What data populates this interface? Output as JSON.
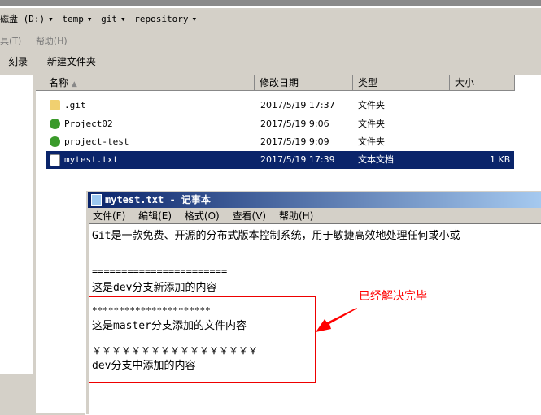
{
  "address": {
    "parts": [
      "磁盘 (D:)",
      "temp",
      "git",
      "repository"
    ]
  },
  "menu": [
    "具(T)",
    "帮助(H)"
  ],
  "toolbar": [
    "刻录",
    "新建文件夹"
  ],
  "columns": [
    "名称",
    "修改日期",
    "类型",
    "大小"
  ],
  "files": [
    {
      "name": ".git",
      "date": "2017/5/19 17:37",
      "type": "文件夹",
      "size": "",
      "icon": "folder-icon"
    },
    {
      "name": "Project02",
      "date": "2017/5/19 9:06",
      "type": "文件夹",
      "size": "",
      "icon": "git-folder-icon"
    },
    {
      "name": "project-test",
      "date": "2017/5/19 9:09",
      "type": "文件夹",
      "size": "",
      "icon": "git-folder-icon"
    },
    {
      "name": "mytest.txt",
      "date": "2017/5/19 17:39",
      "type": "文本文档",
      "size": "1 KB",
      "icon": "text-file-icon",
      "selected": true
    }
  ],
  "notepad": {
    "title": "mytest.txt - 记事本",
    "menu": [
      "文件(F)",
      "编辑(E)",
      "格式(O)",
      "查看(V)",
      "帮助(H)"
    ],
    "lines": [
      "Git是一款免费、开源的分布式版本控制系统，用于敏捷高效地处理任何或小或",
      "=======================",
      "这是dev分支新添加的内容",
      "**********************",
      "这是master分支添加的文件内容",
      "￥￥￥￥￥￥￥￥￥￥￥￥￥￥￥￥￥",
      "dev分支中添加的内容"
    ]
  },
  "annotation": "已经解决完毕"
}
